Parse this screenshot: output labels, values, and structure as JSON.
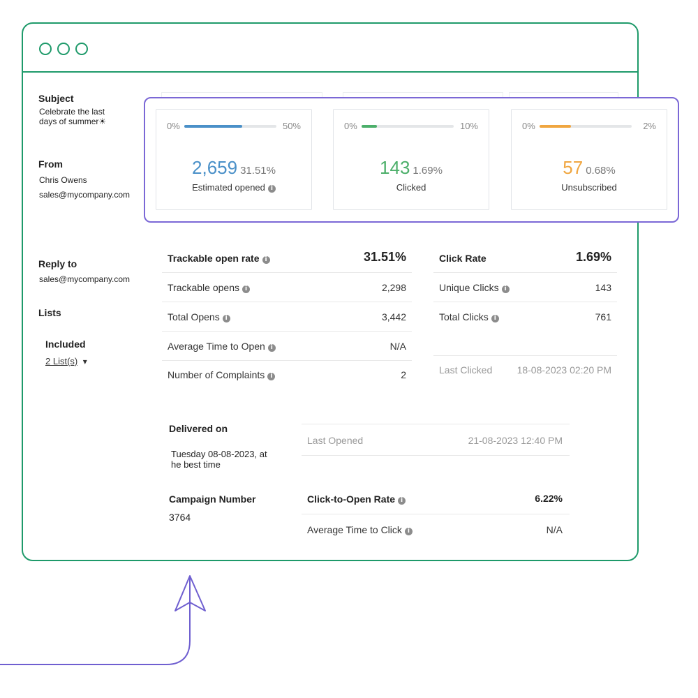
{
  "left": {
    "subject_label": "Subject",
    "subject_line1": "Celebrate the last",
    "subject_line2": "days of summer☀",
    "from_label": "From",
    "from_name": "Chris Owens",
    "from_email": "sales@mycompany.com",
    "reply_label": "Reply to",
    "reply_email": "sales@mycompany.com",
    "lists_label": "Lists",
    "included_label": "Included",
    "included_value": "2 List(s)",
    "dropdown_glyph": "▾"
  },
  "cards": [
    {
      "lo": "0%",
      "hi": "50%",
      "fill": 0.6302,
      "color": "#4a90c8",
      "value": "2,659",
      "pct": "31.51%",
      "label": "Estimated opened",
      "info": true
    },
    {
      "lo": "0%",
      "hi": "10%",
      "fill": 0.169,
      "color": "#4caf6a",
      "value": "143",
      "pct": "1.69%",
      "label": "Clicked",
      "info": false
    },
    {
      "lo": "0%",
      "hi": "2%",
      "fill": 0.34,
      "color": "#f0a640",
      "value": "57",
      "pct": "0.68%",
      "label": "Unsubscribed",
      "info": false
    }
  ],
  "open_stats": [
    {
      "k": "Trackable open rate",
      "v": "31.51%"
    },
    {
      "k": "Trackable opens",
      "v": "2,298"
    },
    {
      "k": "Total Opens",
      "v": "3,442"
    },
    {
      "k": "Average Time to Open",
      "v": "N/A"
    },
    {
      "k": "Number of Complaints",
      "v": "2"
    }
  ],
  "click_stats": [
    {
      "k": "Click Rate",
      "v": "1.69%"
    },
    {
      "k": "Unique Clicks",
      "v": "143"
    },
    {
      "k": "Total Clicks",
      "v": "761"
    }
  ],
  "last_clicked": {
    "k": "Last Clicked",
    "v": "18-08-2023 02:20 PM"
  },
  "delivered": {
    "label": "Delivered on",
    "line1": "Tuesday 08-08-2023, at",
    "line2": "he best time"
  },
  "last_opened": {
    "k": "Last Opened",
    "v": "21-08-2023 12:40 PM"
  },
  "campaign": {
    "label": "Campaign Number",
    "value": "3764"
  },
  "cto": [
    {
      "k": "Click-to-Open Rate",
      "v": "6.22%"
    },
    {
      "k": "Average Time to Click",
      "v": "N/A"
    }
  ],
  "colors": {
    "frame": "#1e9a6a",
    "highlight": "#7b68d6",
    "arrow": "#6f5fd0"
  },
  "icons": {
    "info": "info-icon",
    "arrow": "paper-plane-arrow-icon"
  }
}
